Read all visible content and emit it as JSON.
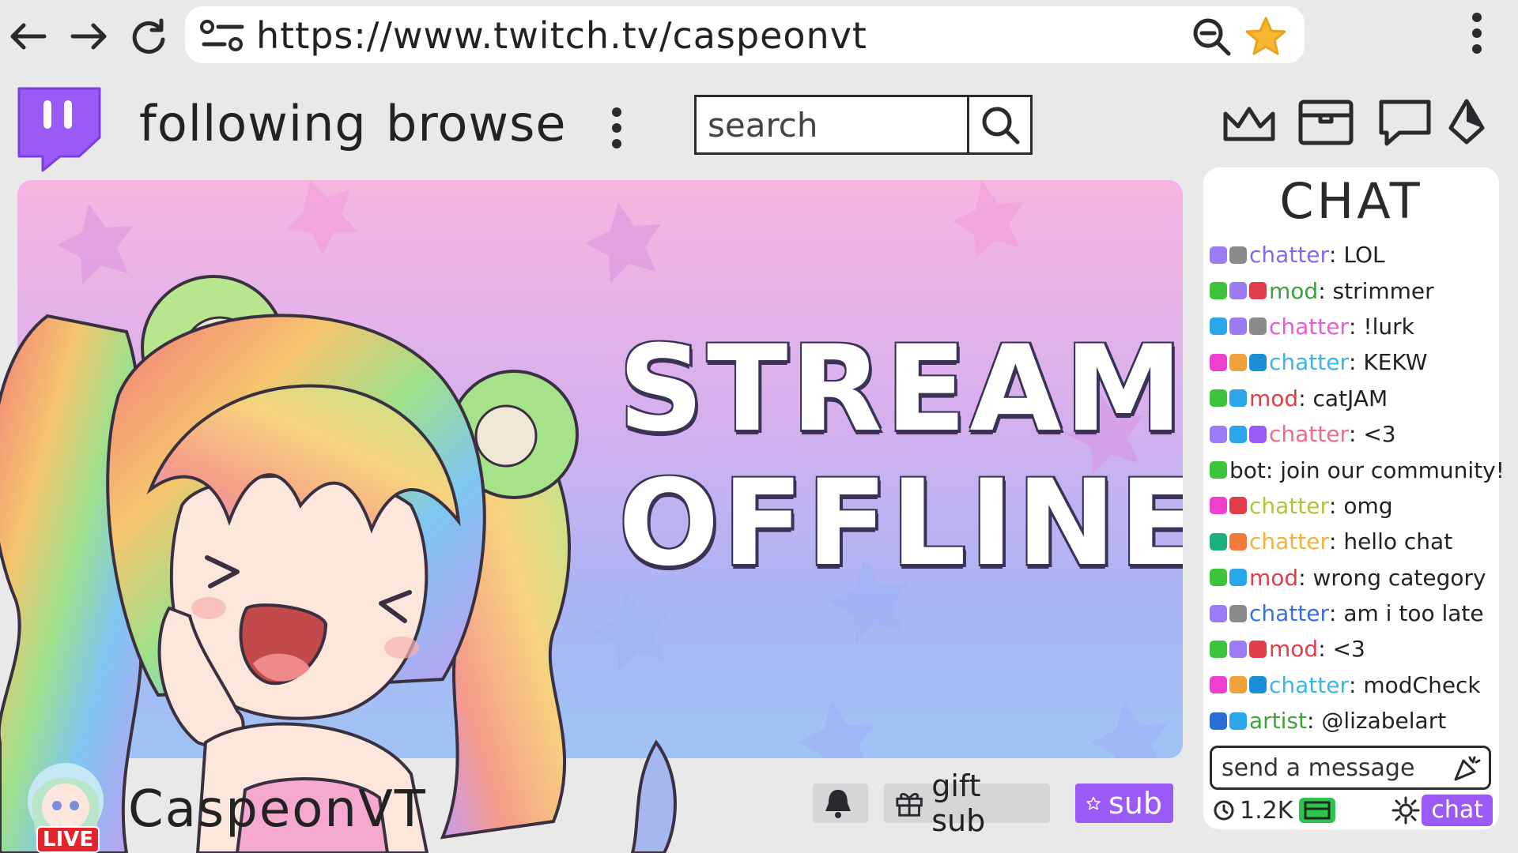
{
  "browser": {
    "url": "https://www.twitch.tv/caspeonvt"
  },
  "header": {
    "nav": [
      "following",
      "browse"
    ],
    "search_placeholder": "search"
  },
  "stream": {
    "offline_line1": "STREAM",
    "offline_line2": "OFFLINE"
  },
  "channel": {
    "name": "CaspeonVT",
    "live_label": "LIVE",
    "gift_label": "gift sub",
    "sub_label": "sub"
  },
  "chat": {
    "title": "CHAT",
    "messages": [
      {
        "user": "chatter",
        "sep": ":",
        "text": " LOL",
        "color": "#7b6cf0",
        "badges": [
          "#9b7cf5",
          "#8a8a8a"
        ]
      },
      {
        "user": "mod",
        "sep": ":",
        "text": " strimmer",
        "color": "#3ca33c",
        "badges": [
          "#3cc43c",
          "#9b7cf5",
          "#e23d4b"
        ]
      },
      {
        "user": "chatter",
        "sep": ":",
        "text": " !lurk",
        "color": "#e75bd6",
        "badges": [
          "#2aa7ea",
          "#9b7cf5",
          "#8a8a8a"
        ]
      },
      {
        "user": "chatter",
        "sep": ":",
        "text": " KEKW",
        "color": "#3ab6e6",
        "badges": [
          "#f03fce",
          "#f2a23a",
          "#1b8ed8"
        ]
      },
      {
        "user": "mod",
        "sep": ":",
        "text": " catJAM",
        "color": "#e23d4b",
        "badges": [
          "#3cc43c",
          "#2aa7ea"
        ]
      },
      {
        "user": "chatter",
        "sep": ":",
        "text": " <3",
        "color": "#f06a8a",
        "badges": [
          "#9b7cf5",
          "#2aa7ea",
          "#9b59f5"
        ]
      },
      {
        "user": "bot",
        "sep": ":",
        "text": " join our community!",
        "color": "#222222",
        "badges": [
          "#3cc43c"
        ]
      },
      {
        "user": "chatter",
        "sep": ":",
        "text": " omg",
        "color": "#a8c83a",
        "badges": [
          "#f03fce",
          "#e23d4b"
        ]
      },
      {
        "user": "chatter",
        "sep": ":",
        "text": " hello chat",
        "color": "#f2b23a",
        "badges": [
          "#1bb07c",
          "#f27a3a"
        ]
      },
      {
        "user": "mod",
        "sep": ":",
        "text": " wrong category",
        "color": "#e23d4b",
        "badges": [
          "#3cc43c",
          "#2aa7ea"
        ]
      },
      {
        "user": "chatter",
        "sep": ":",
        "text": " am i too late",
        "color": "#3a6fd8",
        "badges": [
          "#9b7cf5",
          "#8a8a8a"
        ]
      },
      {
        "user": "mod",
        "sep": ":",
        "text": " <3",
        "color": "#e23d4b",
        "badges": [
          "#3cc43c",
          "#9b7cf5",
          "#e23d4b"
        ]
      },
      {
        "user": "chatter",
        "sep": ":",
        "text": " modCheck",
        "color": "#3ab6e6",
        "badges": [
          "#f03fce",
          "#f2a23a",
          "#1b8ed8"
        ]
      },
      {
        "user": "artist",
        "sep": ":",
        "text": " @lizabelart",
        "color": "#3ca33c",
        "badges": [
          "#2a6fd8",
          "#2aa7ea"
        ]
      }
    ],
    "input_placeholder": "send a message",
    "viewers": "1.2K",
    "chat_button": "chat"
  },
  "colors": {
    "accent": "#9b59f5",
    "live": "#e3242b",
    "star": "#f7b731"
  }
}
